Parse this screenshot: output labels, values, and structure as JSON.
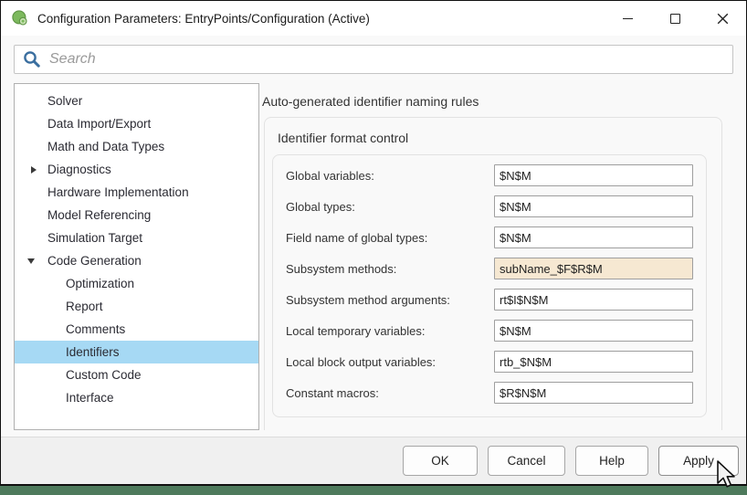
{
  "window": {
    "title": "Configuration Parameters: EntryPoints/Configuration (Active)"
  },
  "search": {
    "placeholder": "Search"
  },
  "sidebar": {
    "items": [
      {
        "label": "Solver",
        "level": 1,
        "arrow": "none",
        "selected": false
      },
      {
        "label": "Data Import/Export",
        "level": 1,
        "arrow": "none",
        "selected": false
      },
      {
        "label": "Math and Data Types",
        "level": 1,
        "arrow": "none",
        "selected": false
      },
      {
        "label": "Diagnostics",
        "level": 1,
        "arrow": "collapsed",
        "selected": false
      },
      {
        "label": "Hardware Implementation",
        "level": 1,
        "arrow": "none",
        "selected": false
      },
      {
        "label": "Model Referencing",
        "level": 1,
        "arrow": "none",
        "selected": false
      },
      {
        "label": "Simulation Target",
        "level": 1,
        "arrow": "none",
        "selected": false
      },
      {
        "label": "Code Generation",
        "level": 1,
        "arrow": "expanded",
        "selected": false
      },
      {
        "label": "Optimization",
        "level": 2,
        "arrow": "none",
        "selected": false
      },
      {
        "label": "Report",
        "level": 2,
        "arrow": "none",
        "selected": false
      },
      {
        "label": "Comments",
        "level": 2,
        "arrow": "none",
        "selected": false
      },
      {
        "label": "Identifiers",
        "level": 2,
        "arrow": "none",
        "selected": true
      },
      {
        "label": "Custom Code",
        "level": 2,
        "arrow": "none",
        "selected": false
      },
      {
        "label": "Interface",
        "level": 2,
        "arrow": "none",
        "selected": false
      }
    ]
  },
  "main": {
    "heading": "Auto-generated identifier naming rules",
    "group": {
      "title": "Identifier format control",
      "fields": [
        {
          "label": "Global variables:",
          "value": "$N$M",
          "modified": false
        },
        {
          "label": "Global types:",
          "value": "$N$M",
          "modified": false
        },
        {
          "label": "Field name of global types:",
          "value": "$N$M",
          "modified": false
        },
        {
          "label": "Subsystem methods:",
          "value": "subName_$F$R$M",
          "modified": true
        },
        {
          "label": "Subsystem method arguments:",
          "value": "rt$I$N$M",
          "modified": false
        },
        {
          "label": "Local temporary variables:",
          "value": "$N$M",
          "modified": false
        },
        {
          "label": "Local block output variables:",
          "value": "rtb_$N$M",
          "modified": false
        },
        {
          "label": "Constant macros:",
          "value": "$R$N$M",
          "modified": false
        }
      ]
    }
  },
  "footer": {
    "buttons": [
      "OK",
      "Cancel",
      "Help",
      "Apply"
    ]
  },
  "icons": {
    "app": "simulink-logo",
    "search": "magnifier",
    "window": [
      "minimize",
      "maximize",
      "close"
    ],
    "tree_arrows": [
      "collapsed-triangle",
      "expanded-triangle"
    ],
    "pointer": "mouse-arrow-cursor"
  },
  "colors": {
    "selection_highlight": "#a6d9f4",
    "modified_field_bg": "#f6e8d2",
    "search_icon_blue": "#3a6e9f",
    "simulink_green": "#7db95e",
    "footer_bg": "#f0f0f0",
    "backdrop_green": "#4e7a5c"
  }
}
